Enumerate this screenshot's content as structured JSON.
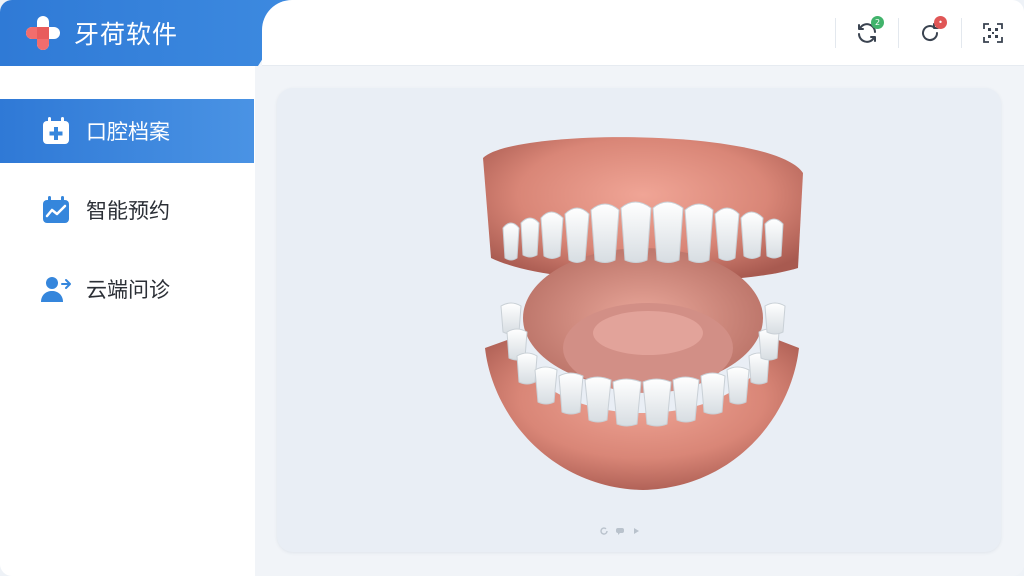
{
  "app": {
    "title": "牙荷软件",
    "accent_color": "#2f7ad6",
    "logo_icon": "medical-cross-logo"
  },
  "topbar": {
    "actions": [
      {
        "name": "sync",
        "icon": "refresh-icon",
        "badge": "2",
        "badge_color": "#41b36b"
      },
      {
        "name": "history",
        "icon": "rotate-icon",
        "badge": "•",
        "badge_color": "#e05656"
      },
      {
        "name": "scan",
        "icon": "qr-scan-icon"
      }
    ]
  },
  "sidebar": {
    "items": [
      {
        "label": "口腔档案",
        "icon": "medical-calendar-icon",
        "active": true
      },
      {
        "label": "智能预约",
        "icon": "calendar-chart-icon",
        "active": false
      },
      {
        "label": "云端问诊",
        "icon": "user-arrow-icon",
        "active": false
      }
    ]
  },
  "main": {
    "viewer": {
      "content": "3d-dental-model",
      "controls": [
        "rotate-icon",
        "chat-icon",
        "play-icon"
      ]
    }
  }
}
